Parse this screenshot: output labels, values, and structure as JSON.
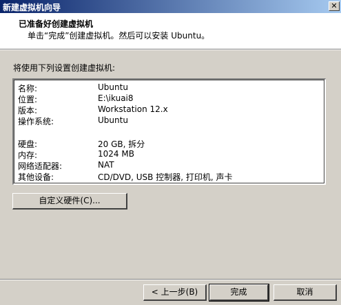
{
  "window": {
    "title": "新建虚拟机向导",
    "close_glyph": "✕"
  },
  "header": {
    "title": "已准备好创建虚拟机",
    "subtitle": "单击“完成”创建虚拟机。然后可以安装 Ubuntu。"
  },
  "intro": "将使用下列设置创建虚拟机:",
  "summary": {
    "rows": [
      {
        "key": "名称:",
        "value": "Ubuntu"
      },
      {
        "key": "位置:",
        "value": "E:\\ikuai8"
      },
      {
        "key": "版本:",
        "value": "Workstation 12.x"
      },
      {
        "key": "操作系统:",
        "value": "Ubuntu"
      },
      {
        "key": "硬盘:",
        "value": "20 GB, 拆分"
      },
      {
        "key": "内存:",
        "value": "1024 MB"
      },
      {
        "key": "网络适配器:",
        "value": "NAT"
      },
      {
        "key": "其他设备:",
        "value": "CD/DVD, USB 控制器, 打印机, 声卡"
      }
    ]
  },
  "buttons": {
    "customize_hardware": "自定义硬件(C)...",
    "back": "< 上一步(B)",
    "finish": "完成",
    "cancel": "取消"
  }
}
